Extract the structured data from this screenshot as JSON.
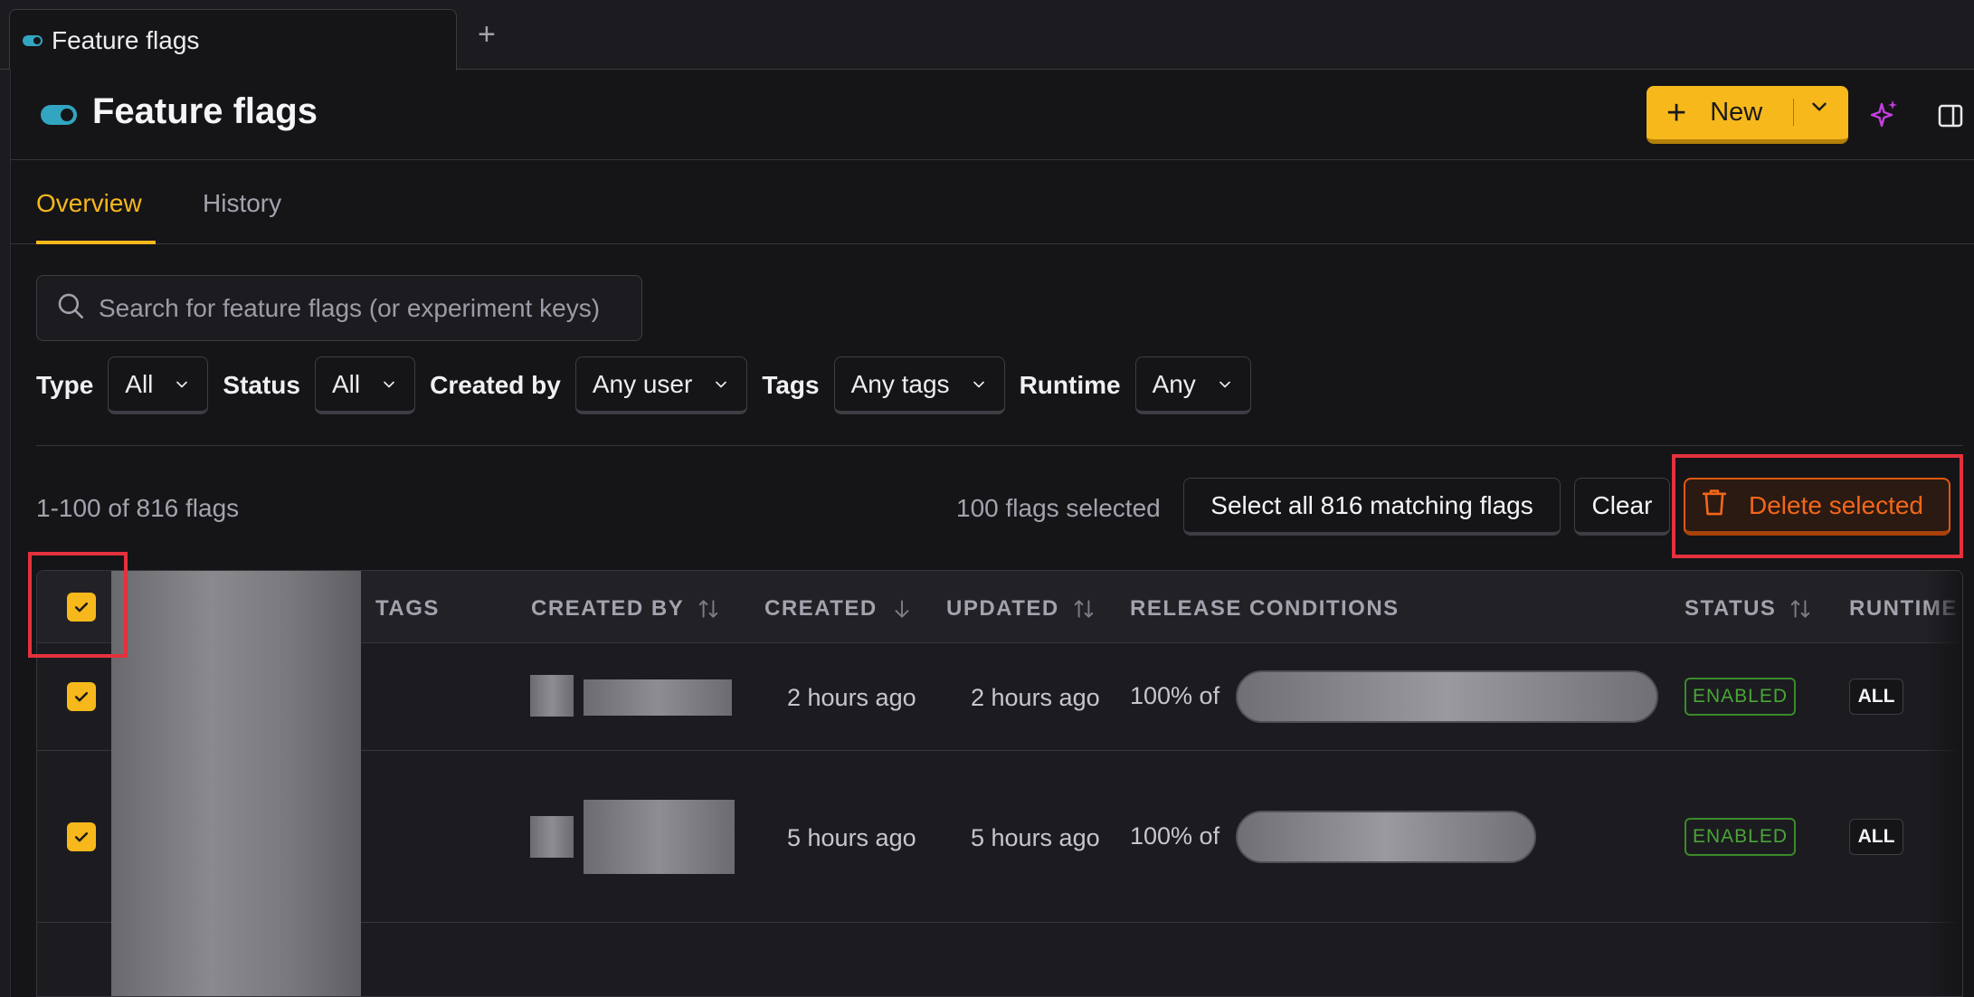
{
  "browser": {
    "tab_label": "Feature flags",
    "new_tab": "+"
  },
  "header": {
    "title": "Feature flags",
    "new_button": "New"
  },
  "tabs": [
    {
      "label": "Overview",
      "active": true
    },
    {
      "label": "History",
      "active": false
    }
  ],
  "search": {
    "placeholder": "Search for feature flags (or experiment keys)"
  },
  "filters": [
    {
      "label": "Type",
      "value": "All"
    },
    {
      "label": "Status",
      "value": "All"
    },
    {
      "label": "Created by",
      "value": "Any user"
    },
    {
      "label": "Tags",
      "value": "Any tags"
    },
    {
      "label": "Runtime",
      "value": "Any"
    }
  ],
  "results": {
    "count": "1-100 of 816 flags",
    "selected": "100 flags selected",
    "select_all": "Select all 816 matching flags",
    "clear": "Clear",
    "delete": "Delete selected"
  },
  "table": {
    "columns": {
      "tags": "TAGS",
      "created_by": "CREATED BY",
      "created": "CREATED",
      "updated": "UPDATED",
      "release": "RELEASE CONDITIONS",
      "status": "STATUS",
      "runtime": "RUNTIME"
    },
    "rows": [
      {
        "created": "2 hours ago",
        "updated": "2 hours ago",
        "release": "100% of",
        "status": "ENABLED",
        "runtime": "ALL"
      },
      {
        "created": "5 hours ago",
        "updated": "5 hours ago",
        "release": "100% of",
        "status": "ENABLED",
        "runtime": "ALL"
      }
    ]
  },
  "colors": {
    "accent": "#f7b81c",
    "danger": "#f4661a",
    "enabled": "#49a536",
    "toggle": "#32a5c0",
    "highlight": "#e5313d"
  }
}
